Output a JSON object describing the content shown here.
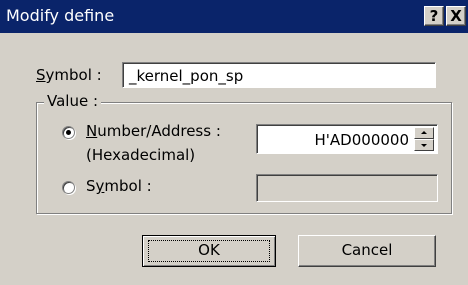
{
  "dialog": {
    "title": "Modify define",
    "help_glyph": "?",
    "close_glyph": "X"
  },
  "symbol_row": {
    "label_mnemonic": "S",
    "label_rest": "ymbol :",
    "value": "_kernel_pon_sp"
  },
  "value_group": {
    "legend": "Value :",
    "number_option": {
      "label_mnemonic": "N",
      "label_rest": "umber/Address :",
      "sublabel": "(Hexadecimal)",
      "selected": true,
      "value": "H'AD000000"
    },
    "symbol_option": {
      "label_pre": "S",
      "label_mnemonic": "y",
      "label_rest": "mbol :",
      "selected": false,
      "value": ""
    }
  },
  "buttons": {
    "ok": "OK",
    "cancel": "Cancel"
  }
}
